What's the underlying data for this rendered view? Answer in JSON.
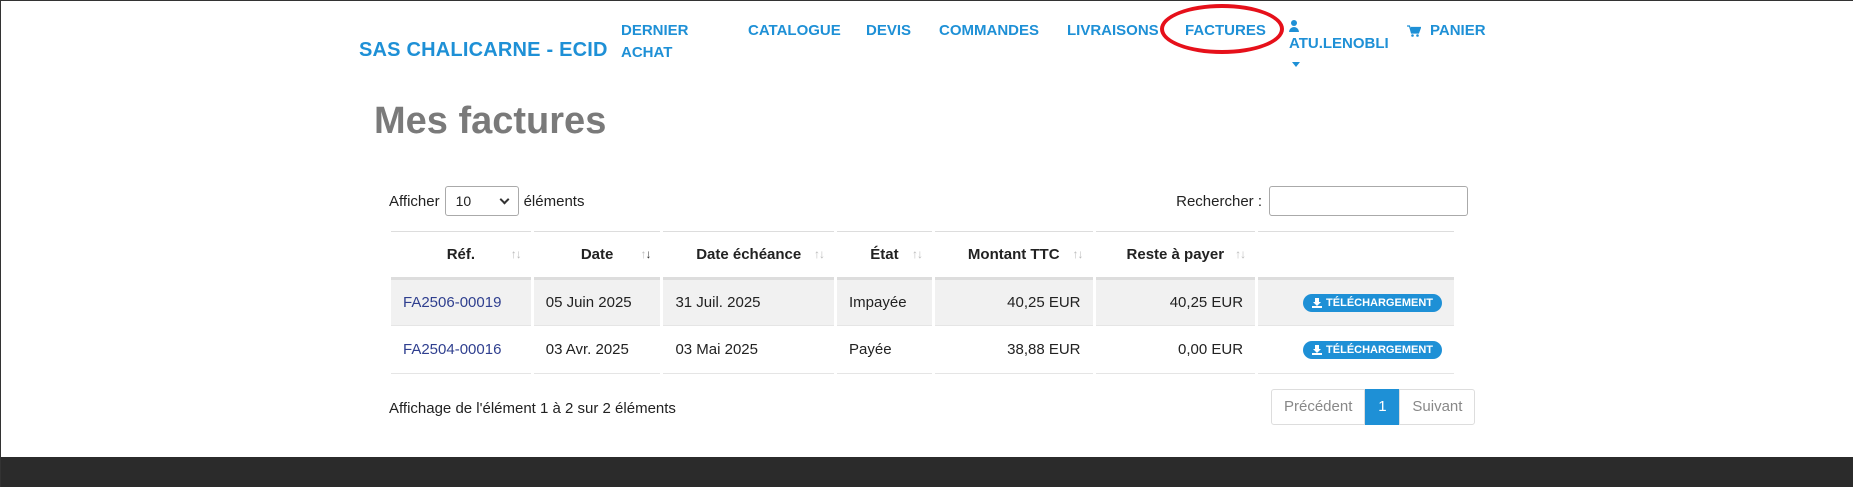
{
  "navbar": {
    "brand": "SAS CHALICARNE - ECID",
    "items": [
      {
        "label_line1": "DERNIER",
        "label_line2": "ACHAT"
      },
      {
        "label": "CATALOGUE"
      },
      {
        "label": "DEVIS"
      },
      {
        "label": "COMMANDES"
      },
      {
        "label": "LIVRAISONS"
      },
      {
        "label": "FACTURES"
      }
    ],
    "user": "ATU.LENOBLI",
    "cart": "PANIER",
    "highlight_color": "#e6101a"
  },
  "page_title": "Mes factures",
  "controls": {
    "show_prefix": "Afficher",
    "page_length": "10",
    "show_suffix": "éléments",
    "search_label": "Rechercher :",
    "search_value": ""
  },
  "table": {
    "headers": [
      "Réf.",
      "Date",
      "Date échéance",
      "État",
      "Montant TTC",
      "Reste à payer"
    ],
    "rows": [
      {
        "ref": "FA2506-00019",
        "date": "05 Juin 2025",
        "due": "31 Juil. 2025",
        "status": "Impayée",
        "amount": "40,25 EUR",
        "remaining": "40,25 EUR",
        "action": "TÉLÉCHARGEMENT"
      },
      {
        "ref": "FA2504-00016",
        "date": "03 Avr. 2025",
        "due": "03 Mai 2025",
        "status": "Payée",
        "amount": "38,88 EUR",
        "remaining": "0,00 EUR",
        "action": "TÉLÉCHARGEMENT"
      }
    ]
  },
  "footer": {
    "info": "Affichage de l'élément 1 à 2 sur 2 éléments",
    "prev": "Précédent",
    "current_page": "1",
    "next": "Suivant"
  },
  "colors": {
    "accent": "#1e90d6",
    "title_gray": "#7a7a7a",
    "footer_dark": "#2b2b2b"
  }
}
